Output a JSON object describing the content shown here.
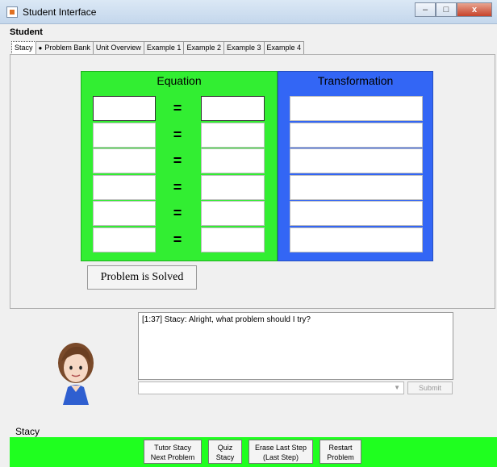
{
  "window": {
    "title": "Student Interface",
    "minimize": "–",
    "maximize": "□",
    "close": "x"
  },
  "menu": {
    "student_label": "Student"
  },
  "tabs": [
    {
      "label": "Stacy",
      "active": true
    },
    {
      "label": "Problem Bank",
      "icon": "pin-icon"
    },
    {
      "label": "Unit Overview"
    },
    {
      "label": "Example 1"
    },
    {
      "label": "Example 2"
    },
    {
      "label": "Example 3"
    },
    {
      "label": "Example 4"
    }
  ],
  "equation_panel": {
    "heading": "Equation",
    "equals_sign": "=",
    "color": "#32ee32"
  },
  "transformation_panel": {
    "heading": "Transformation",
    "color": "#3366f5"
  },
  "solved_button": {
    "label": "Problem is Solved"
  },
  "chat": {
    "messages": [
      "[1:37] Stacy: Alright, what problem should I try?"
    ],
    "input_value": "",
    "submit_label": "Submit"
  },
  "agent": {
    "name": "Stacy",
    "avatar": "girl-avatar-icon"
  },
  "bottom_bar": {
    "color": "#1fff1f",
    "buttons": [
      {
        "line1": "Tutor Stacy",
        "line2": "Next Problem"
      },
      {
        "line1": "Quiz",
        "line2": "Stacy"
      },
      {
        "line1": "Erase Last Step",
        "line2": "(Last Step)"
      },
      {
        "line1": "Restart",
        "line2": "Problem"
      }
    ]
  }
}
